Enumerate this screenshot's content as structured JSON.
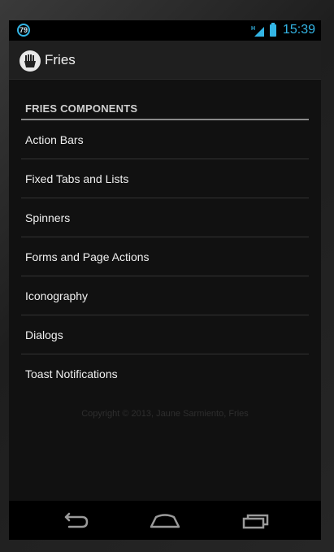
{
  "status_bar": {
    "notification_count": "79",
    "network_type": "H",
    "time": "15:39",
    "accent_color": "#33b5e5",
    "icons": [
      "notification-badge-icon",
      "signal-icon",
      "battery-icon"
    ]
  },
  "action_bar": {
    "title": "Fries",
    "icon": "fries-logo-icon"
  },
  "section": {
    "header": "FRIES COMPONENTS",
    "items": [
      {
        "label": "Action Bars"
      },
      {
        "label": "Fixed Tabs and Lists"
      },
      {
        "label": "Spinners"
      },
      {
        "label": "Forms and Page Actions"
      },
      {
        "label": "Iconography"
      },
      {
        "label": "Dialogs"
      },
      {
        "label": "Toast Notifications"
      }
    ]
  },
  "footer": {
    "text": "Copyright © 2013, Jaune Sarmiento, Fries"
  },
  "nav_bar": {
    "icons": [
      "back-icon",
      "home-icon",
      "recent-apps-icon"
    ]
  }
}
